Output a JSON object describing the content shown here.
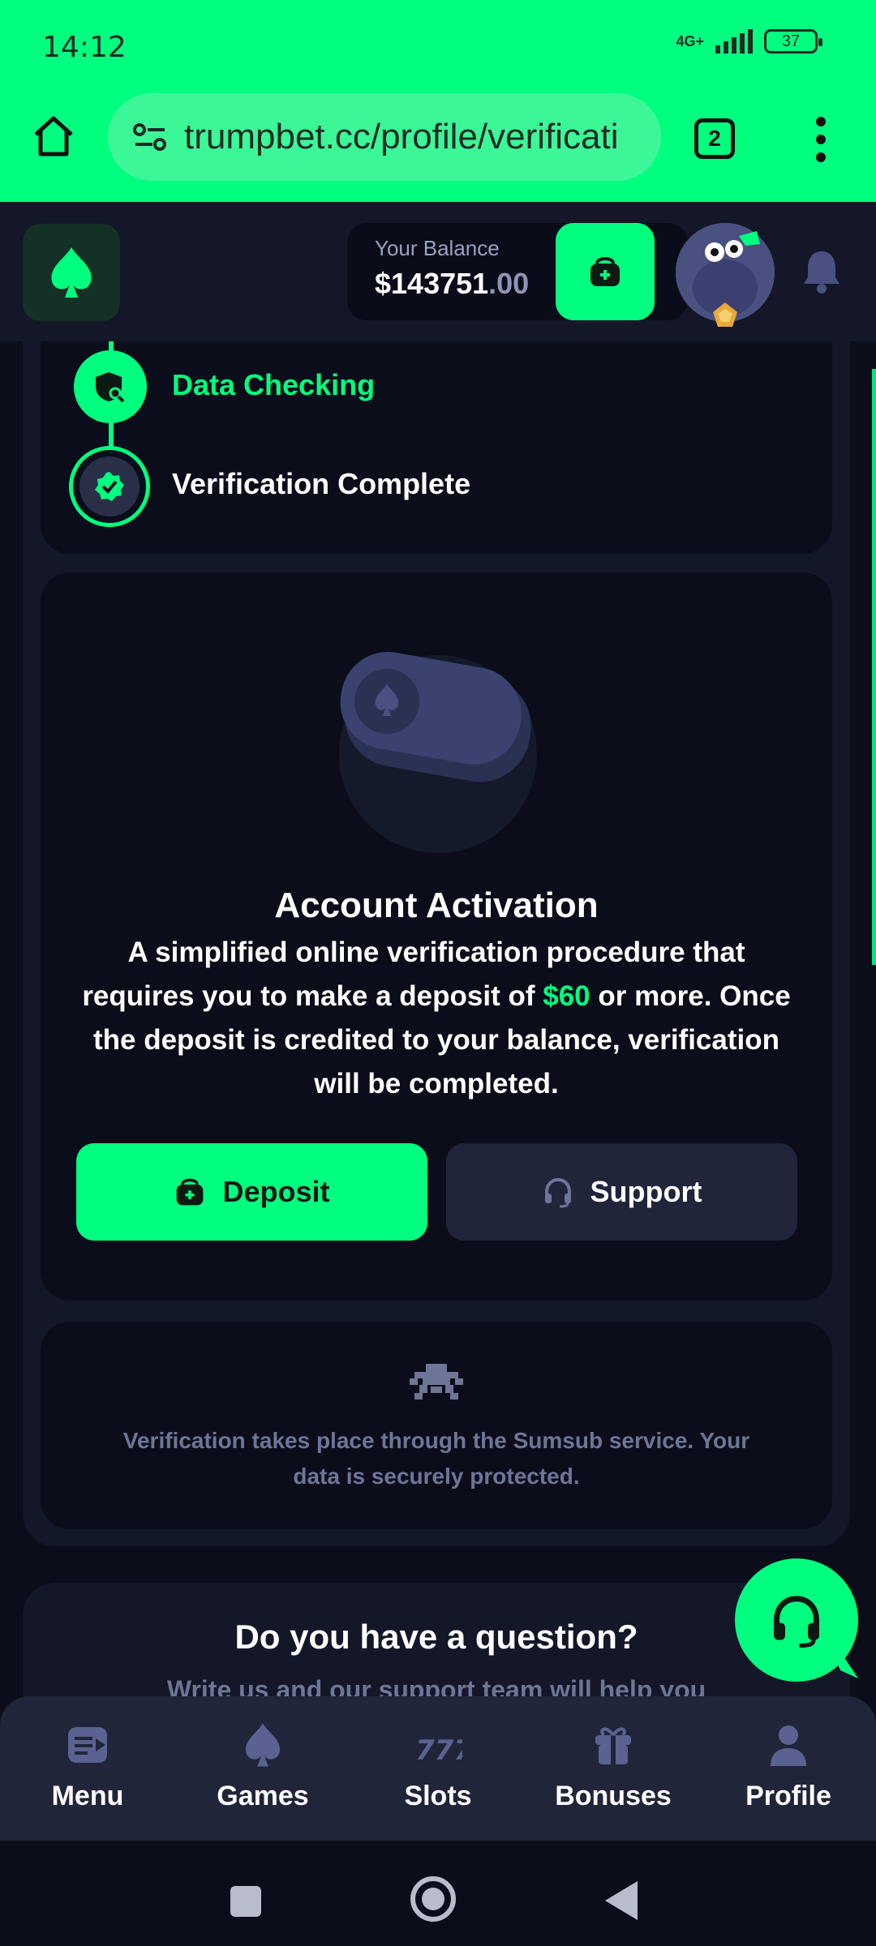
{
  "status_bar": {
    "time": "14:12",
    "network": "4G+",
    "battery": "37"
  },
  "browser": {
    "url": "trumpbet.cc/profile/verificati",
    "tab_count": "2"
  },
  "header": {
    "balance_label": "Your Balance",
    "balance_whole": "$143751",
    "balance_cents": ".00"
  },
  "steps": [
    {
      "label": "Data Checking",
      "state": "active"
    },
    {
      "label": "Verification Complete",
      "state": "pending"
    }
  ],
  "activation": {
    "title": "Account Activation",
    "desc_part1": "A simplified online verification procedure that requires you to make a deposit of",
    "amount": "$60",
    "desc_part2": "or more. Once the deposit is credited to your balance, verification will be completed.",
    "deposit_label": "Deposit",
    "support_label": "Support"
  },
  "sumsub": {
    "text": "Verification takes place through the Sumsub service. Your data is securely protected."
  },
  "question": {
    "title": "Do you have a question?",
    "subtitle": "Write us and our support team will help you"
  },
  "bottom_nav": [
    {
      "label": "Menu",
      "icon": "menu-icon"
    },
    {
      "label": "Games",
      "icon": "spade-icon"
    },
    {
      "label": "Slots",
      "icon": "slots-777-icon"
    },
    {
      "label": "Bonuses",
      "icon": "gift-icon"
    },
    {
      "label": "Profile",
      "icon": "user-icon"
    }
  ],
  "colors": {
    "accent": "#00ff7f",
    "background": "#0b0e1a",
    "panel": "#131728",
    "muted": "#6f7596"
  }
}
